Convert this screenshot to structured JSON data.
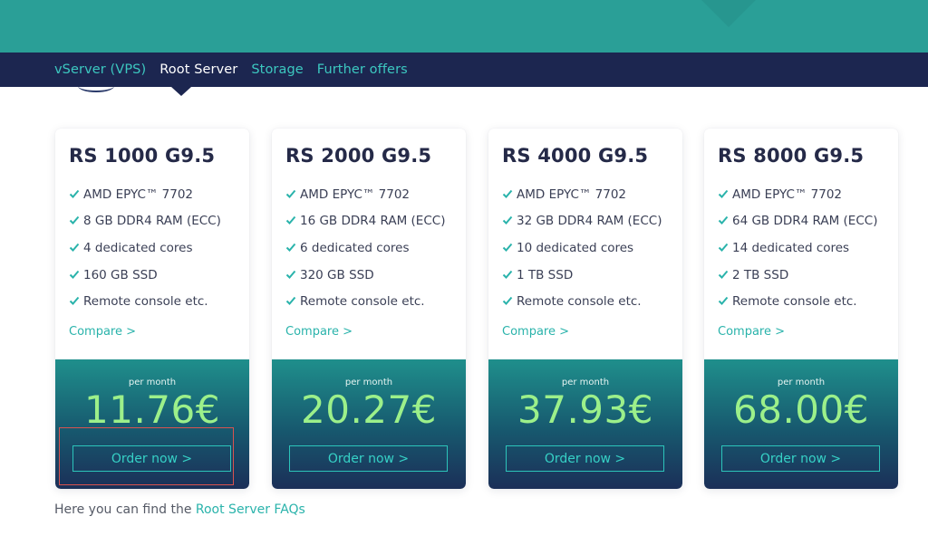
{
  "nav": {
    "tabs": [
      {
        "label": "vServer (VPS)",
        "active": false
      },
      {
        "label": "Root Server",
        "active": true
      },
      {
        "label": "Storage",
        "active": false
      },
      {
        "label": "Further offers",
        "active": false
      }
    ]
  },
  "cards": [
    {
      "title": "RS 1000 G9.5",
      "features": [
        "AMD EPYC™ 7702",
        "8 GB DDR4 RAM (ECC)",
        "4 dedicated cores",
        "160 GB SSD",
        "Remote console etc."
      ],
      "compare_label": "Compare >",
      "per_month_label": "per month",
      "price": "11.76€",
      "order_label": "Order now >"
    },
    {
      "title": "RS 2000 G9.5",
      "features": [
        "AMD EPYC™ 7702",
        "16 GB DDR4 RAM (ECC)",
        "6 dedicated cores",
        "320 GB SSD",
        "Remote console etc."
      ],
      "compare_label": "Compare >",
      "per_month_label": "per month",
      "price": "20.27€",
      "order_label": "Order now >"
    },
    {
      "title": "RS 4000 G9.5",
      "features": [
        "AMD EPYC™ 7702",
        "32 GB DDR4 RAM (ECC)",
        "10 dedicated cores",
        "1 TB SSD",
        "Remote console etc."
      ],
      "compare_label": "Compare >",
      "per_month_label": "per month",
      "price": "37.93€",
      "order_label": "Order now >"
    },
    {
      "title": "RS 8000 G9.5",
      "features": [
        "AMD EPYC™ 7702",
        "64 GB DDR4 RAM (ECC)",
        "14 dedicated cores",
        "2 TB SSD",
        "Remote console etc."
      ],
      "compare_label": "Compare >",
      "per_month_label": "per month",
      "price": "68.00€",
      "order_label": "Order now >"
    }
  ],
  "faq": {
    "prefix": "Here you can find the ",
    "link_label": "Root Server FAQs"
  },
  "colors": {
    "header_teal": "#2a9f97",
    "nav_navy": "#1c2650",
    "accent_teal": "#2ab3ab",
    "price_green": "#9cf08a"
  },
  "icons": {
    "feature": "check-icon"
  }
}
